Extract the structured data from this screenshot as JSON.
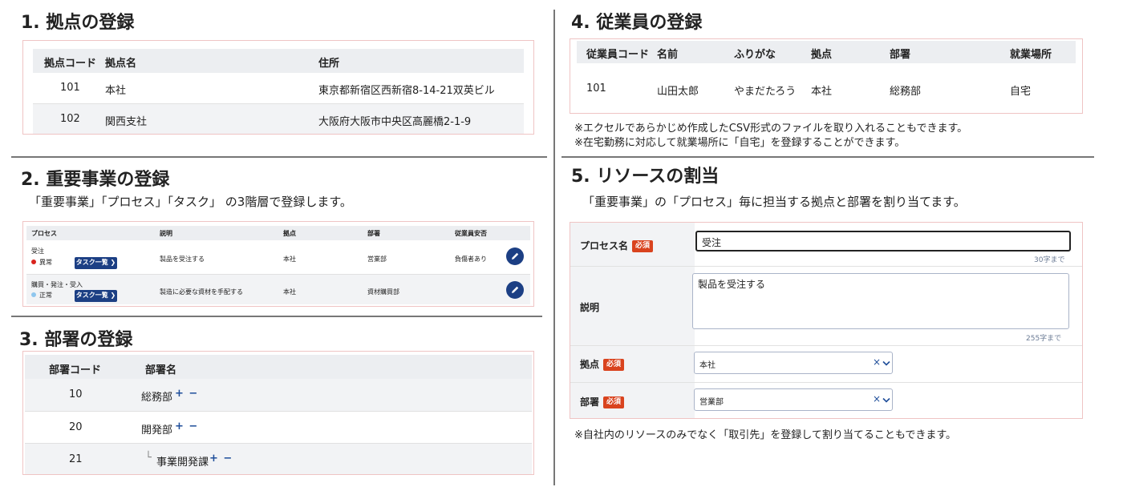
{
  "s1": {
    "title": "1. 拠点の登録",
    "headers": [
      "拠点コード",
      "拠点名",
      "住所"
    ],
    "rows": [
      [
        "101",
        "本社",
        "東京都新宿区西新宿8-14-21双英ビル"
      ],
      [
        "102",
        "関西支社",
        "大阪府大阪市中央区高麗橋2-1-9"
      ]
    ]
  },
  "s2": {
    "title": "2. 重要事業の登録",
    "subtitle": "「重要事業」「プロセス」「タスク」 の3階層で登録します。",
    "headers": [
      "プロセス",
      "説明",
      "拠点",
      "部署",
      "従業員安否"
    ],
    "rows": [
      {
        "name": "受注",
        "status": "異常",
        "status_color": "#d9231d",
        "button": "タスク一覧 ❯",
        "desc": "製品を受注する",
        "site": "本社",
        "dept": "営業部",
        "safety": "負傷者あり"
      },
      {
        "name": "購買・発注・受入",
        "status": "正常",
        "status_color": "#8fc6ee",
        "button": "タスク一覧 ❯",
        "desc": "製造に必要な資材を手配する",
        "site": "本社",
        "dept": "資材購買部",
        "safety": ""
      }
    ],
    "edit_icon": "pencil-icon"
  },
  "s3": {
    "title": "3. 部署の登録",
    "headers": [
      "部署コード",
      "部署名"
    ],
    "rows": [
      {
        "code": "10",
        "name": "総務部",
        "prefix": "",
        "actions": "+ −"
      },
      {
        "code": "20",
        "name": "開発部",
        "prefix": "",
        "actions": "+ −"
      },
      {
        "code": "21",
        "name": "事業開発課",
        "prefix": "└",
        "actions": "+ −"
      }
    ]
  },
  "s4": {
    "title": "4. 従業員の登録",
    "headers": [
      "従業員コード",
      "名前",
      "ふりがな",
      "拠点",
      "部署",
      "就業場所"
    ],
    "row": [
      "101",
      "山田太郎",
      "やまだたろう",
      "本社",
      "総務部",
      "自宅"
    ],
    "notes": [
      "※エクセルであらかじめ作成したCSV形式のファイルを取り入れることもできます。",
      "※在宅勤務に対応して就業場所に「自宅」を登録することができます。"
    ]
  },
  "s5": {
    "title": "5. リソースの割当",
    "subtitle": "「重要事業」の「プロセス」毎に担当する拠点と部署を割り当てます。",
    "required": "必須",
    "process_label": "プロセス名",
    "process_value": "受注",
    "process_count": "30字まで",
    "desc_label": "説明",
    "desc_value": "製品を受注する",
    "desc_count": "255字まで",
    "site_label": "拠点",
    "site_value": "本社",
    "dept_label": "部署",
    "dept_value": "営業部",
    "clear_icon": "×",
    "chevron_icon": "chevron-down-icon",
    "note": "※自社内のリソースのみでなく「取引先」を登録して割り当てることもできます。"
  },
  "colors": {
    "accent": "#1c3f84",
    "required": "#d9431e",
    "card_border": "#efc4c4"
  }
}
